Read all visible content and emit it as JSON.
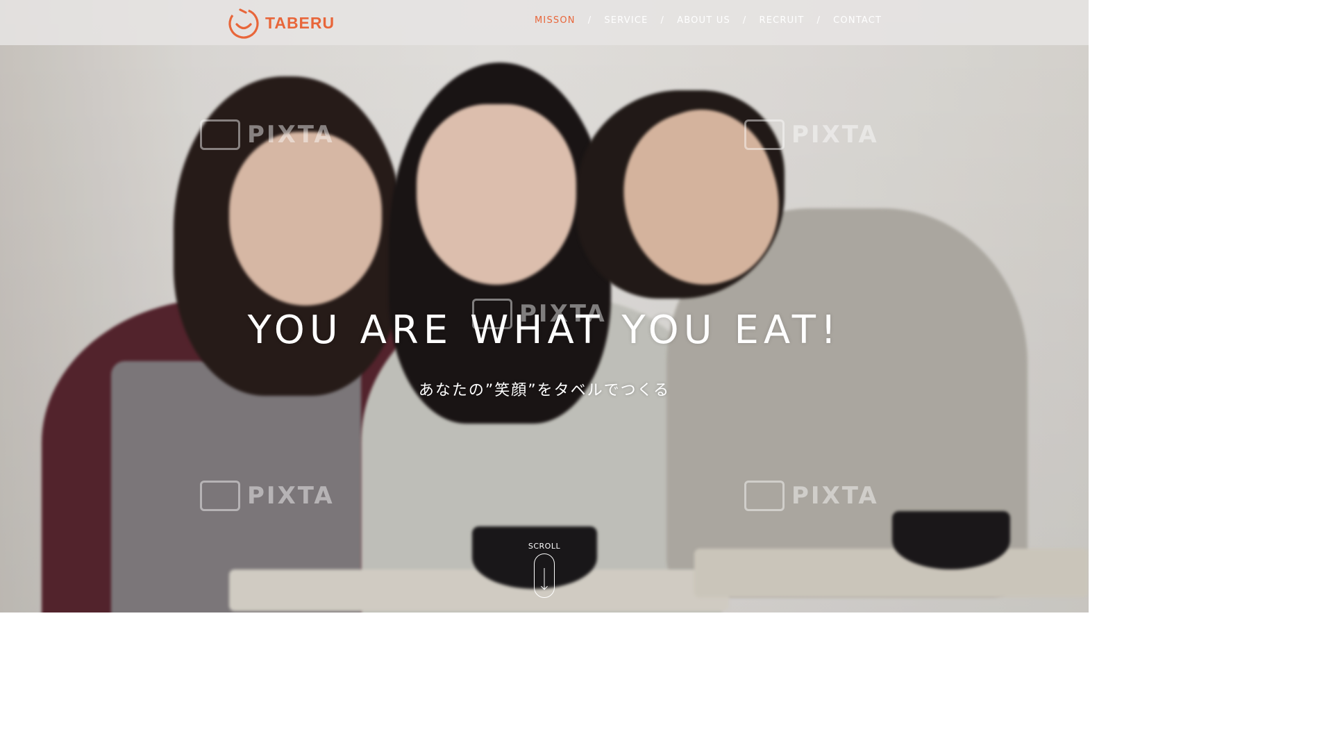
{
  "brand": {
    "name": "TABERU",
    "accent_color": "#e8663a"
  },
  "nav": {
    "items": [
      {
        "label": "MISSON",
        "active": true
      },
      {
        "label": "SERVICE",
        "active": false
      },
      {
        "label": "ABOUT US",
        "active": false
      },
      {
        "label": "RECRUIT",
        "active": false
      },
      {
        "label": "CONTACT",
        "active": false
      }
    ],
    "separator": "/"
  },
  "hero": {
    "headline": "YOU ARE WHAT YOU EAT!",
    "subheadline": "あなたの”笑顔”をタベルでつくる",
    "image": "smiling-women-lunch-photo"
  },
  "scroll": {
    "label": "SCROLL",
    "icon": "scroll-down-icon"
  },
  "watermark": {
    "text": "PIXTA"
  }
}
